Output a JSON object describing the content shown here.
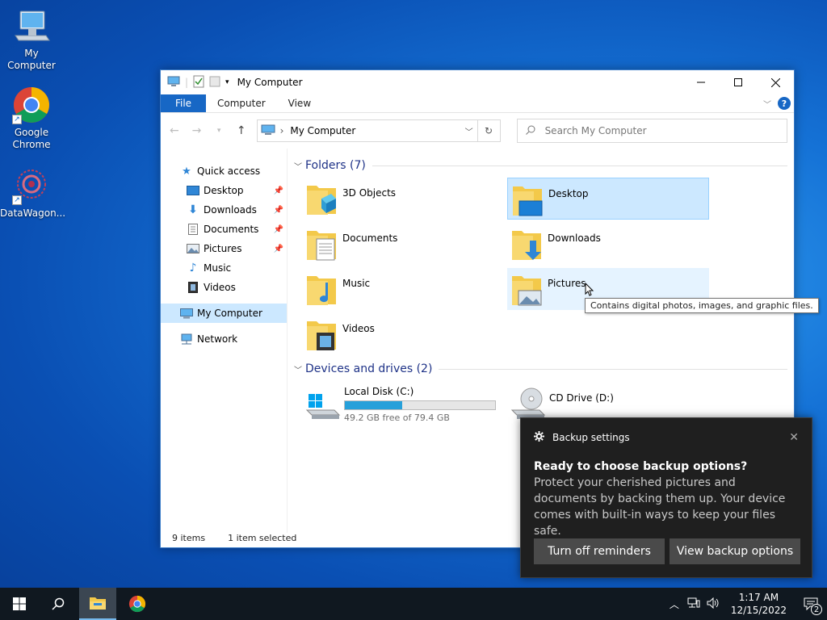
{
  "desktop": {
    "icons": [
      {
        "label": "My Computer"
      },
      {
        "label": "Google Chrome"
      },
      {
        "label": "DataWagon..."
      }
    ]
  },
  "window": {
    "title": "My Computer",
    "ribbon_tabs": [
      "File",
      "Computer",
      "View"
    ],
    "address": "My Computer",
    "search_placeholder": "Search My Computer",
    "sidebar": {
      "quick_access": "Quick access",
      "items": [
        {
          "label": "Desktop",
          "pinned": true
        },
        {
          "label": "Downloads",
          "pinned": true
        },
        {
          "label": "Documents",
          "pinned": true
        },
        {
          "label": "Pictures",
          "pinned": true
        },
        {
          "label": "Music",
          "pinned": false
        },
        {
          "label": "Videos",
          "pinned": false
        }
      ],
      "this_pc": "My Computer",
      "network": "Network"
    },
    "folders_header": "Folders (7)",
    "folders": [
      {
        "name": "3D Objects"
      },
      {
        "name": "Desktop"
      },
      {
        "name": "Documents"
      },
      {
        "name": "Downloads"
      },
      {
        "name": "Music"
      },
      {
        "name": "Pictures"
      },
      {
        "name": "Videos"
      }
    ],
    "devices_header": "Devices and drives (2)",
    "drives": [
      {
        "name": "Local Disk (C:)",
        "free": "49.2 GB free of 79.4 GB",
        "used_fraction": 0.38
      },
      {
        "name": "CD Drive (D:)"
      }
    ],
    "status": {
      "items": "9 items",
      "selected": "1 item selected"
    },
    "tooltip": "Contains digital photos, images, and graphic files."
  },
  "toast": {
    "app": "Backup settings",
    "title": "Ready to choose backup options?",
    "body": "Protect your cherished pictures and documents by backing them up. Your device comes with built-in ways to keep your files safe.",
    "button_left": "Turn off reminders",
    "button_right": "View backup options"
  },
  "taskbar": {
    "time": "1:17 AM",
    "date": "12/15/2022",
    "notification_count": "2"
  },
  "colors": {
    "accent": "#1767c5",
    "selection": "#cce8ff",
    "drive_bar": "#26a0da",
    "folder_yellow": "#f3c94a"
  }
}
